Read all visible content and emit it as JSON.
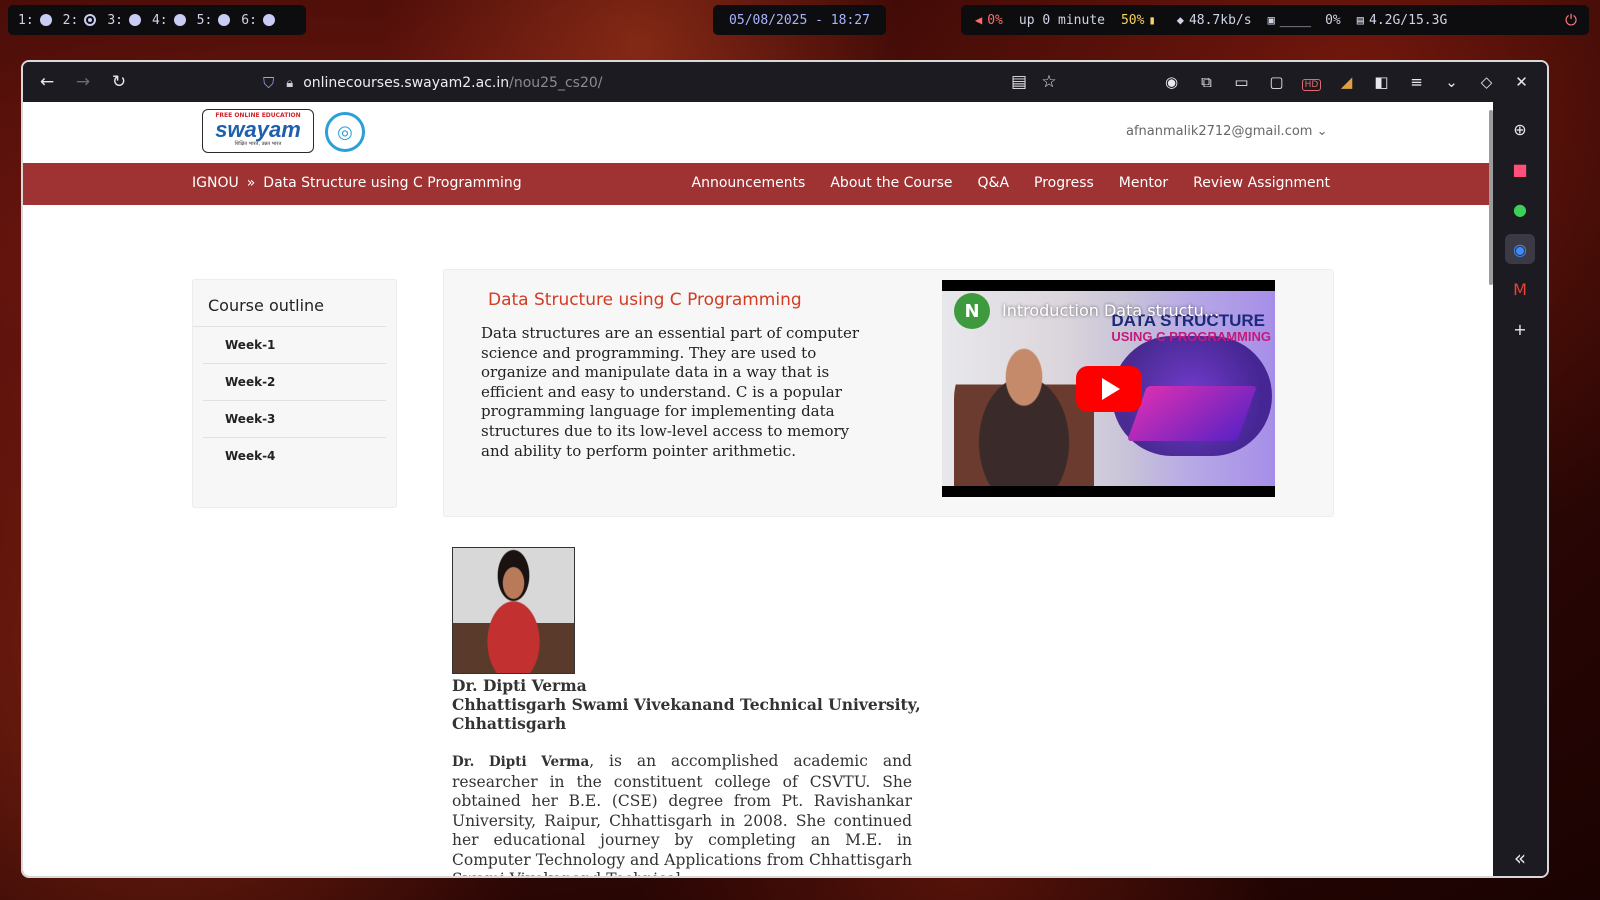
{
  "statusbar": {
    "workspaces": [
      {
        "num": "1:",
        "active": false
      },
      {
        "num": "2:",
        "active": true
      },
      {
        "num": "3:",
        "active": false
      },
      {
        "num": "4:",
        "active": false
      },
      {
        "num": "5:",
        "active": false
      },
      {
        "num": "6:",
        "active": false
      }
    ],
    "clock": "05/08/2025 - 18:27",
    "volume": "0%",
    "uptime": "up 0 minute",
    "battery": "50%",
    "network": "48.7kb/s",
    "cpu_graph": "____",
    "cpu": "0%",
    "memory": "4.2G/15.3G"
  },
  "browser": {
    "url_host": "onlinecourses.swayam2.ac.in",
    "url_path": "/nou25_cs20/",
    "hd_badge": "HD"
  },
  "site": {
    "logo_tagline": "FREE ONLINE EDUCATION",
    "logo_word": "swayam",
    "logo_sub": "शिक्षित भारत, उन्नत भारत",
    "user_email": "afnanmalik2712@gmail.com",
    "breadcrumb": {
      "root": "IGNOU",
      "sep": "»",
      "current": "Data Structure using C Programming"
    },
    "nav": [
      "Announcements",
      "About the Course",
      "Q&A",
      "Progress",
      "Mentor",
      "Review Assignment"
    ]
  },
  "outline": {
    "title": "Course outline",
    "weeks": [
      "Week-1",
      "Week-2",
      "Week-3",
      "Week-4"
    ]
  },
  "course": {
    "title": "Data Structure using C Programming",
    "description": "Data structures are an essential part of computer science and programming. They are used to organize and manipulate data in a way that is efficient and easy to understand. C is a popular programming language for implementing data structures due to its low-level access to memory and ability to perform pointer arithmetic.",
    "video": {
      "channel_initial": "N",
      "title": "Introduction Data structu...",
      "brand_line1": "DATA STRUCTURE",
      "brand_line2": "USING C PROGRAMMING"
    }
  },
  "instructor": {
    "name": "Dr. Dipti Verma",
    "affiliation": "Chhattisgarh Swami Vivekanand Technical University, Chhattisgarh",
    "bio_name": "Dr. Dipti Verma",
    "bio_rest": ", is an accomplished academic and researcher in the constituent college of CSVTU. She obtained her B.E. (CSE) degree from Pt. Ravishankar University, Raipur, Chhattisgarh in 2008. She continued her educational journey by completing an M.E. in Computer Technology and Applications from Chhattisgarh Swami Vivekanand Technical"
  },
  "colors": {
    "navbar": "#9f3232",
    "course_title": "#d33b22",
    "accent_clock": "#a9b4ff"
  }
}
